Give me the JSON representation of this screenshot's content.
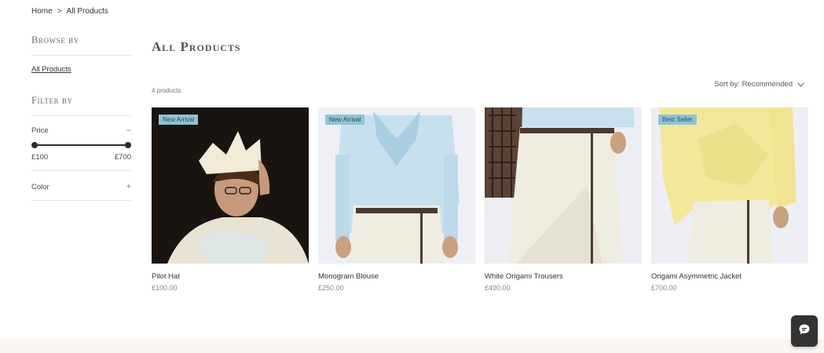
{
  "breadcrumb": {
    "home": "Home",
    "separator": ">",
    "current": "All Products"
  },
  "sidebar": {
    "browse_heading": "Browse by",
    "browse_link": "All Products",
    "filter_heading": "Filter by",
    "price_label": "Price",
    "price_toggle": "–",
    "price_min": "£100",
    "price_max": "£700",
    "color_label": "Color",
    "color_toggle": "+"
  },
  "main": {
    "title": "All Products",
    "count": "4 products",
    "sort_label": "Sort by: Recommended"
  },
  "products": [
    {
      "name": "Pilot Hat",
      "price": "£100.00",
      "badge": "New Arrival"
    },
    {
      "name": "Monogram Blouse",
      "price": "£250.00",
      "badge": "New Arrival"
    },
    {
      "name": "White Origami Trousers",
      "price": "£490.00",
      "badge": ""
    },
    {
      "name": "Origami Asymmetric Jacket",
      "price": "£700.00",
      "badge": "Best Seller"
    }
  ],
  "colors": {
    "badge_bg": "#8fc4d4",
    "chat_bg": "#333333",
    "footer_band": "#fbf6f1"
  },
  "icons": {
    "sort": "chevron-down-icon",
    "chat": "chat-icon"
  }
}
